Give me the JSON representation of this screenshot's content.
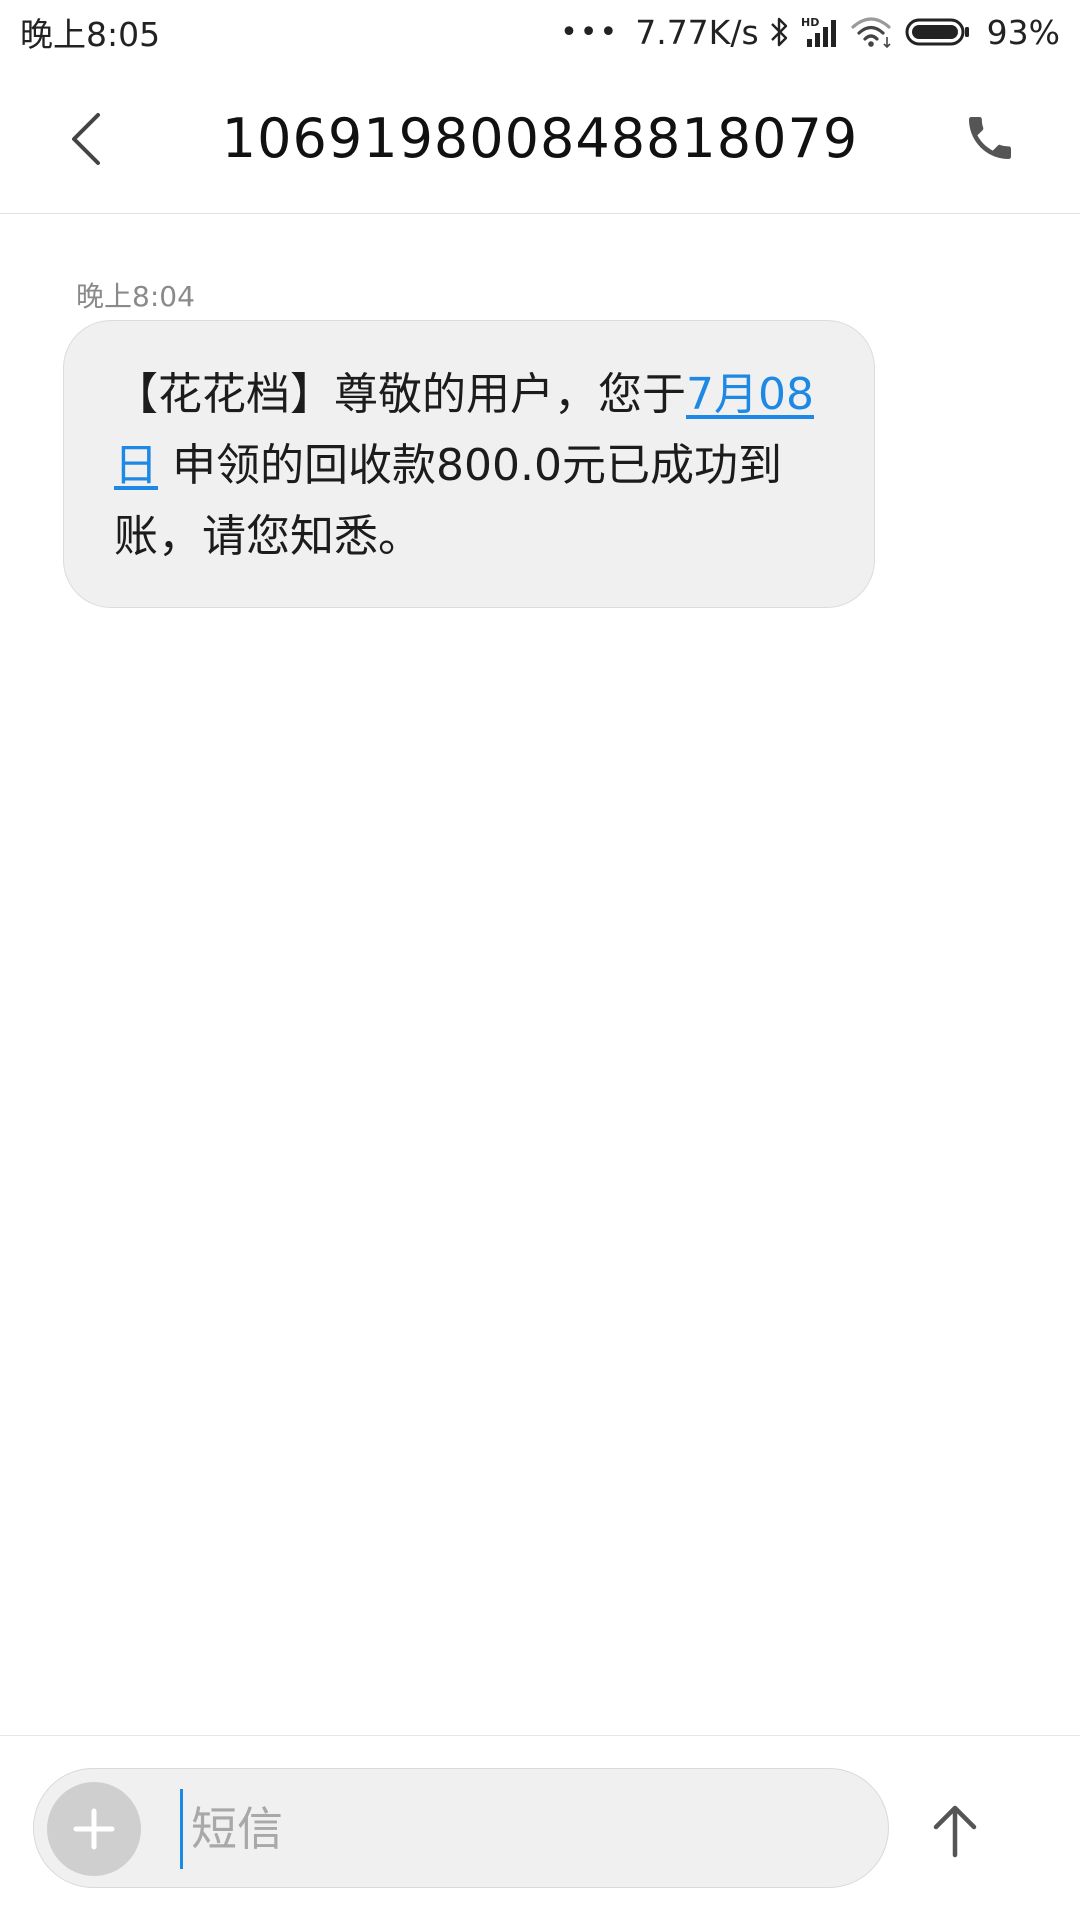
{
  "status_bar": {
    "time": "晚上8:05",
    "dots": "•••",
    "network_speed": "7.77K/s",
    "battery": "93%",
    "icons": [
      "bluetooth-icon",
      "hd-signal-icon",
      "wifi-icon",
      "battery-icon"
    ]
  },
  "header": {
    "back_icon": "chevron-left-icon",
    "title": "1069198008488​18079",
    "call_icon": "phone-icon"
  },
  "messages": [
    {
      "time": "晚上8:04",
      "text_before_link": "【花花档】尊敬的用户，您于",
      "link_text": "7月08日",
      "text_after_link": " 申领的回收款800.0元已成功到账，请您知悉。"
    }
  ],
  "compose": {
    "add_icon": "plus-icon",
    "placeholder": "短信",
    "value": "",
    "send_icon": "arrow-up-icon"
  },
  "colors": {
    "link": "#1e88e5",
    "bubble_bg": "#f0f0f0",
    "icon_gray": "#666666"
  }
}
